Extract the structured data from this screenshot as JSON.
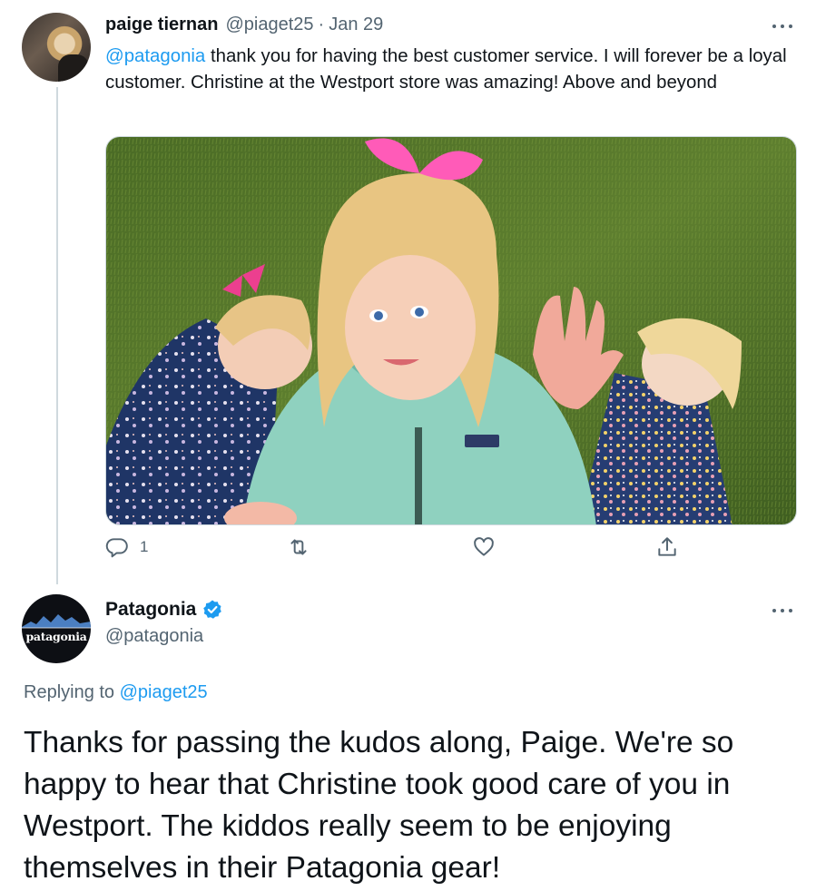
{
  "tweet1": {
    "name": "paige tiernan",
    "handle": "@piaget25",
    "separator": "·",
    "date": "Jan 29",
    "mention": "@patagonia",
    "text": " thank you for having the best customer service. I will forever be a loyal customer. Christine at the Westport store was amazing! Above and beyond",
    "reply_count": "1"
  },
  "tweet2": {
    "name": "Patagonia",
    "handle": "@patagonia",
    "avatar_logo": "patagonia",
    "replying_prefix": "Replying to ",
    "replying_handle": "@piaget25",
    "text": "Thanks for passing the kudos along, Paige. We're so happy to hear that Christine took good care of you in Westport. The kiddos really seem to be enjoying themselves in their Patagonia gear!"
  },
  "icons": {
    "reply": "reply-icon",
    "retweet": "retweet-icon",
    "like": "heart-icon",
    "share": "share-icon",
    "more": "more-icon",
    "verified": "verified-badge-icon"
  },
  "colors": {
    "link": "#1d9bf0",
    "secondary_text": "#536471",
    "thread_line": "#cfd9de"
  }
}
